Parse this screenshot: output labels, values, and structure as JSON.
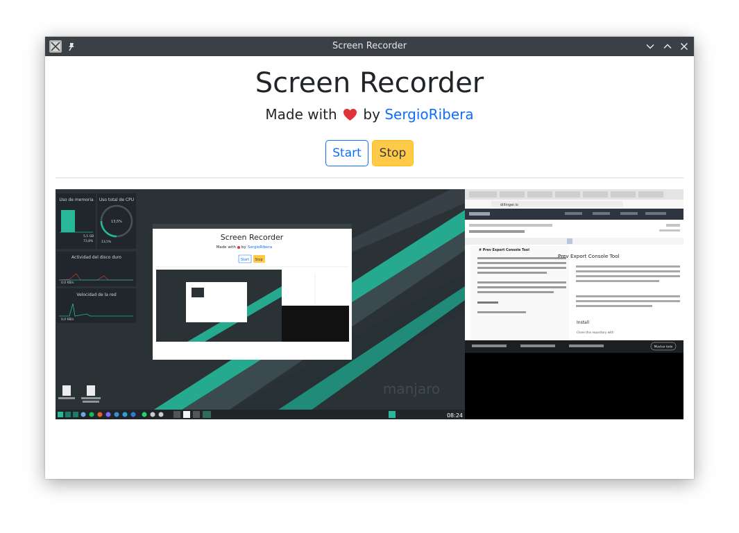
{
  "window": {
    "title": "Screen Recorder"
  },
  "page": {
    "heading": "Screen Recorder",
    "made_with": "Made with",
    "by": "by",
    "author": "SergioRibera",
    "heart_icon": "heart-icon",
    "start_label": "Start",
    "stop_label": "Stop"
  },
  "preview": {
    "memory_widget_title": "Uso de memoria",
    "cpu_widget_title": "Uso total de CPU",
    "memory_used": "5,5 GB",
    "memory_percent": "73,8%",
    "cpu_percent": "13,5%",
    "disk_widget_title": "Actividad del disco duro",
    "disk_value": "0,0 KB/s",
    "net_widget_title": "Velocidad de la red",
    "net_value": "0,0 KB/s",
    "desktop_brand": "manjaro",
    "nested_heading": "Screen Recorder",
    "nested_made_with": "Made with",
    "nested_by": "by",
    "nested_author": "SergioRibera",
    "nested_start": "Start",
    "nested_stop": "Stop",
    "clock": "08:24",
    "browser_url": "dillinger.io",
    "doc_title": "Prev Export Console Tool",
    "doc_heading_install": "Install",
    "doc_line_install": "Clone this repository with",
    "editor_md_heading": "# Prev Export Console Tool",
    "show_all_label": "Mostrar todo"
  },
  "colors": {
    "titlebar": "#3b4046",
    "accent_blue": "#0d6efd",
    "stop_yellow": "#ffc94a",
    "heart_red": "#e0323a"
  }
}
